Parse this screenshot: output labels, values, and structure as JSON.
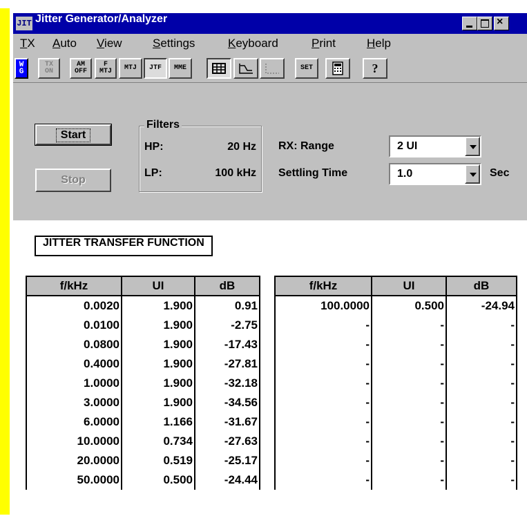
{
  "window": {
    "icon_text": "JIT",
    "title": "Jitter Generator/Analyzer"
  },
  "menu": [
    "TX",
    "Auto",
    "View",
    "Settings",
    "Keyboard",
    "Print",
    "Help"
  ],
  "toolbar": {
    "wg": "W\nG",
    "tx_on": "TX\nON",
    "am_off": "AM\nOFF",
    "f_mtj": "F\nMTJ",
    "mtj": "MTJ",
    "jtf": "JTF",
    "mme": "MME",
    "set": "SET"
  },
  "controls": {
    "start_label": "Start",
    "stop_label": "Stop",
    "filters_title": "Filters",
    "hp_label": "HP:",
    "hp_value": "20 Hz",
    "lp_label": "LP:",
    "lp_value": "100 kHz",
    "rx_range_label": "RX: Range",
    "rx_range_value": "2 UI",
    "settling_label": "Settling Time",
    "settling_value": "1.0",
    "settling_unit": "Sec"
  },
  "table_title": "JITTER TRANSFER FUNCTION",
  "table_headers": [
    "f/kHz",
    "UI",
    "dB"
  ],
  "left_rows": [
    [
      "0.0020",
      "1.900",
      "0.91"
    ],
    [
      "0.0100",
      "1.900",
      "-2.75"
    ],
    [
      "0.0800",
      "1.900",
      "-17.43"
    ],
    [
      "0.4000",
      "1.900",
      "-27.81"
    ],
    [
      "1.0000",
      "1.900",
      "-32.18"
    ],
    [
      "3.0000",
      "1.900",
      "-34.56"
    ],
    [
      "6.0000",
      "1.166",
      "-31.67"
    ],
    [
      "10.0000",
      "0.734",
      "-27.63"
    ],
    [
      "20.0000",
      "0.519",
      "-25.17"
    ],
    [
      "50.0000",
      "0.500",
      "-24.44"
    ]
  ],
  "right_rows": [
    [
      "100.0000",
      "0.500",
      "-24.94"
    ],
    [
      "-",
      "-",
      "-"
    ],
    [
      "-",
      "-",
      "-"
    ],
    [
      "-",
      "-",
      "-"
    ],
    [
      "-",
      "-",
      "-"
    ],
    [
      "-",
      "-",
      "-"
    ],
    [
      "-",
      "-",
      "-"
    ],
    [
      "-",
      "-",
      "-"
    ],
    [
      "-",
      "-",
      "-"
    ],
    [
      "-",
      "-",
      "-"
    ]
  ]
}
